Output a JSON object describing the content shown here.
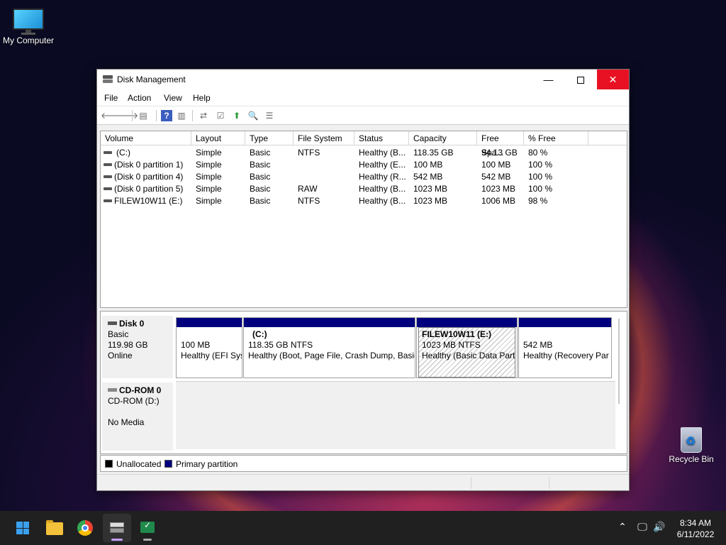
{
  "desktop": {
    "icons": [
      {
        "label": "My Computer"
      },
      {
        "label": "Recycle Bin"
      }
    ]
  },
  "window": {
    "title": "Disk Management",
    "controls": {
      "minimize": "—",
      "maximize": "",
      "close": "✕"
    }
  },
  "menu": [
    "File",
    "Action",
    "View",
    "Help"
  ],
  "toolbar": {
    "icons": [
      "back-icon",
      "forward-icon",
      "show-hide-console-tree-icon",
      "help-icon",
      "action-pane-icon",
      "connect-icon",
      "properties-icon",
      "export-icon",
      "search-icon",
      "list-icon"
    ]
  },
  "volume_list": {
    "columns": [
      "Volume",
      "Layout",
      "Type",
      "File System",
      "Status",
      "Capacity",
      "Free Spa...",
      "% Free"
    ],
    "rows": [
      {
        "volume": "(C:)",
        "layout": "Simple",
        "type": "Basic",
        "fs": "NTFS",
        "status": "Healthy (B...",
        "capacity": "118.35 GB",
        "free": "94.13 GB",
        "pct": "80 %"
      },
      {
        "volume": "(Disk 0 partition 1)",
        "layout": "Simple",
        "type": "Basic",
        "fs": "",
        "status": "Healthy (E...",
        "capacity": "100 MB",
        "free": "100 MB",
        "pct": "100 %"
      },
      {
        "volume": "(Disk 0 partition 4)",
        "layout": "Simple",
        "type": "Basic",
        "fs": "",
        "status": "Healthy (R...",
        "capacity": "542 MB",
        "free": "542 MB",
        "pct": "100 %"
      },
      {
        "volume": "(Disk 0 partition 5)",
        "layout": "Simple",
        "type": "Basic",
        "fs": "RAW",
        "status": "Healthy (B...",
        "capacity": "1023 MB",
        "free": "1023 MB",
        "pct": "100 %"
      },
      {
        "volume": "FILEW10W11 (E:)",
        "layout": "Simple",
        "type": "Basic",
        "fs": "NTFS",
        "status": "Healthy (B...",
        "capacity": "1023 MB",
        "free": "1006 MB",
        "pct": "98 %"
      }
    ]
  },
  "disks": [
    {
      "name": "Disk 0",
      "type": "Basic",
      "size": "119.98 GB",
      "state": "Online",
      "partitions": [
        {
          "title": "",
          "line1": "100 MB",
          "line2": "Healthy (EFI Sys"
        },
        {
          "title": "(C:)",
          "line1": "118.35 GB NTFS",
          "line2": "Healthy (Boot, Page File, Crash Dump, Basic"
        },
        {
          "title": "FILEW10W11  (E:)",
          "line1": "1023 MB NTFS",
          "line2": "Healthy (Basic Data Parti"
        },
        {
          "title": "",
          "line1": "542 MB",
          "line2": "Healthy (Recovery Par"
        }
      ]
    },
    {
      "name": "CD-ROM 0",
      "type": "CD-ROM (D:)",
      "size": "",
      "state": "No Media"
    }
  ],
  "legend": [
    {
      "label": "Unallocated",
      "color": "#000000"
    },
    {
      "label": "Primary partition",
      "color": "#00007f"
    }
  ],
  "taskbar": {
    "apps": [
      "start-icon",
      "file-explorer-icon",
      "chrome-icon",
      "disk-management-icon",
      "app-icon"
    ],
    "tray": [
      "chevron-up-icon",
      "network-icon",
      "volume-icon"
    ],
    "time": "8:34 AM",
    "date": "6/11/2022"
  }
}
